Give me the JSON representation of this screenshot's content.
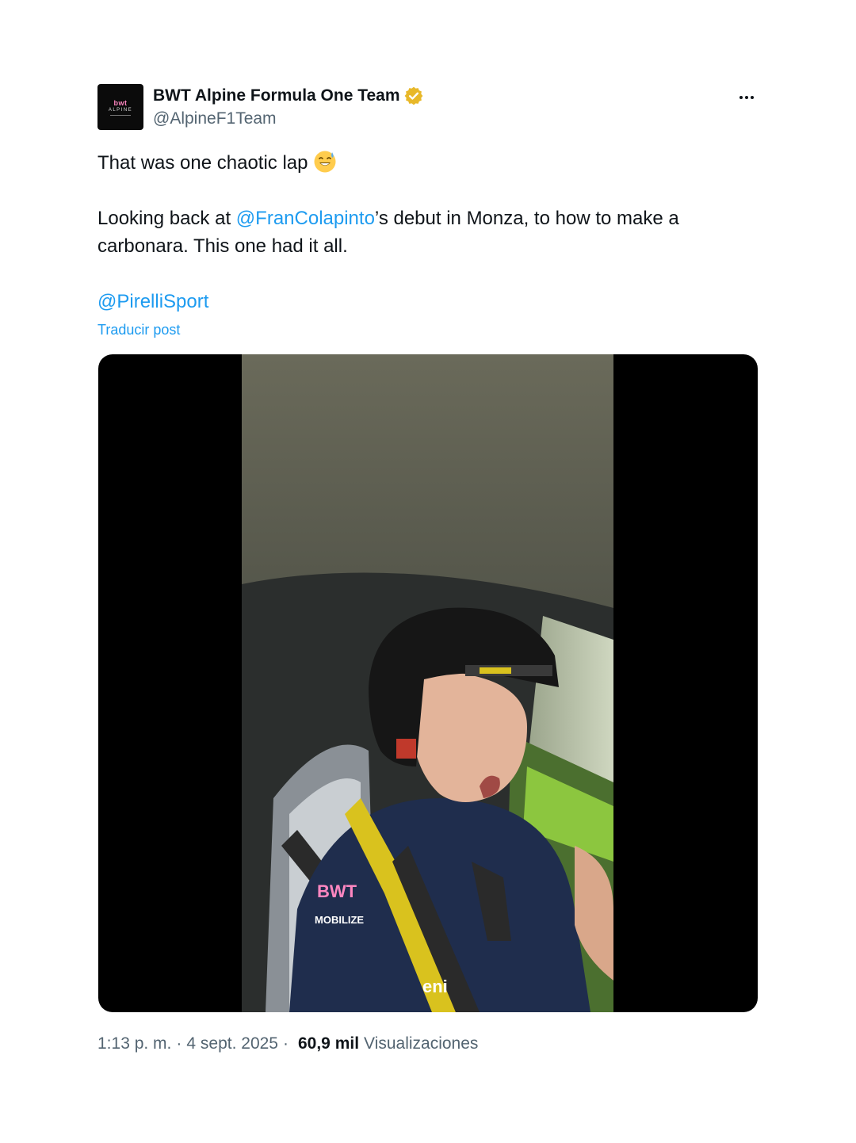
{
  "author": {
    "display_name": "BWT Alpine Formula One Team",
    "handle": "@AlpineF1Team",
    "avatar_text": "bwt ALPINE",
    "verified_badge": "verified-gold-icon"
  },
  "tweet": {
    "line1": "That was one chaotic lap",
    "line1_emoji": "grinning-sweat-emoji",
    "line2_prefix": "Looking back at ",
    "line2_mention": "@FranColapinto",
    "line2_suffix": "’s debut in Monza, to how to make a carbonara. This one had it all.",
    "mention_pirelli": "@PirelliSport",
    "translate_label": "Traducir post"
  },
  "media": {
    "type": "video",
    "logos": [
      "bwt",
      "MOBILIZE",
      "eni"
    ]
  },
  "meta": {
    "time": "1:13 p. m.",
    "date": "4 sept. 2025",
    "views_count": "60,9 mil",
    "views_label": "Visualizaciones"
  },
  "colors": {
    "link": "#1d9bf0",
    "secondary_text": "#536471",
    "primary_text": "#0f1419"
  }
}
